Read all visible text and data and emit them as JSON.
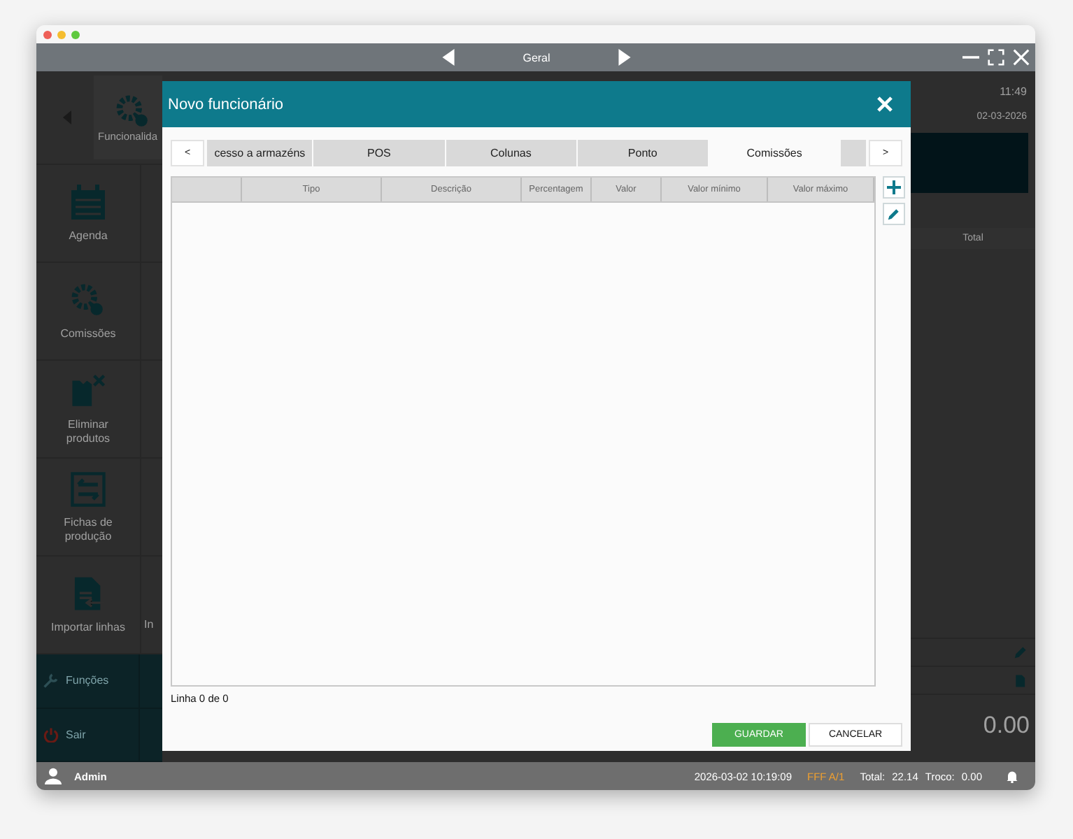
{
  "toolbar": {
    "title": "Geral"
  },
  "sidebar": {
    "items": [
      {
        "label": "Funcionalida",
        "kind": "top"
      },
      {
        "label": "Agenda",
        "kind": "tile"
      },
      {
        "label": "Comissões",
        "kind": "tile"
      },
      {
        "label": "Eliminar produtos",
        "kind": "tile"
      },
      {
        "label": "Fichas de produção",
        "kind": "tile"
      },
      {
        "label": "Importar linhas",
        "kind": "tile",
        "next": "In"
      },
      {
        "label": "Funções",
        "kind": "action"
      },
      {
        "label": "Sair",
        "kind": "exit"
      }
    ]
  },
  "right_panel": {
    "time": "11:49",
    "date": "02-03-2026",
    "column": "Total",
    "amount": "0.00"
  },
  "dialog": {
    "title": "Novo funcionário",
    "tabs": [
      {
        "label": "cesso a armazéns",
        "selected": false
      },
      {
        "label": "POS",
        "selected": false
      },
      {
        "label": "Colunas",
        "selected": false
      },
      {
        "label": "Ponto",
        "selected": false
      },
      {
        "label": "Comissões",
        "selected": true
      }
    ],
    "tab_prev": "<",
    "tab_next": ">",
    "table": {
      "columns": [
        "Tipo",
        "Descrição",
        "Percentagem",
        "Valor",
        "Valor mínimo",
        "Valor máximo"
      ]
    },
    "row_count": "Linha 0 de 0",
    "buttons": [
      {
        "label": "GUARDAR",
        "kind": "primary"
      },
      {
        "label": "CANCELAR",
        "kind": "secondary"
      }
    ]
  },
  "status_bar": {
    "user": "Admin",
    "datetime": "2026-03-02 10:19:09",
    "document": "FFF A/1",
    "total_label": "Total:",
    "total": "22.14",
    "change_label": "Troco:",
    "change": "0.00"
  }
}
